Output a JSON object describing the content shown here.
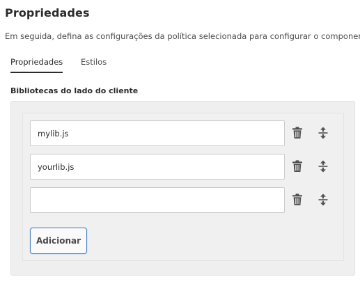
{
  "header": {
    "title": "Propriedades",
    "subtitle": "Em seguida, defina as configurações da política selecionada para configurar o componente"
  },
  "tabs": [
    {
      "label": "Propriedades",
      "active": true
    },
    {
      "label": "Estilos",
      "active": false
    }
  ],
  "section": {
    "label": "Bibliotecas do lado do cliente",
    "items": [
      {
        "value": "mylib.js"
      },
      {
        "value": "yourlib.js"
      },
      {
        "value": ""
      }
    ],
    "add_label": "Adicionar"
  },
  "icons": {
    "delete": "trash-icon",
    "reorder": "move-vertical-icon"
  },
  "colors": {
    "focus_accent": "#4a7fc4",
    "panel_bg": "#efefef"
  }
}
